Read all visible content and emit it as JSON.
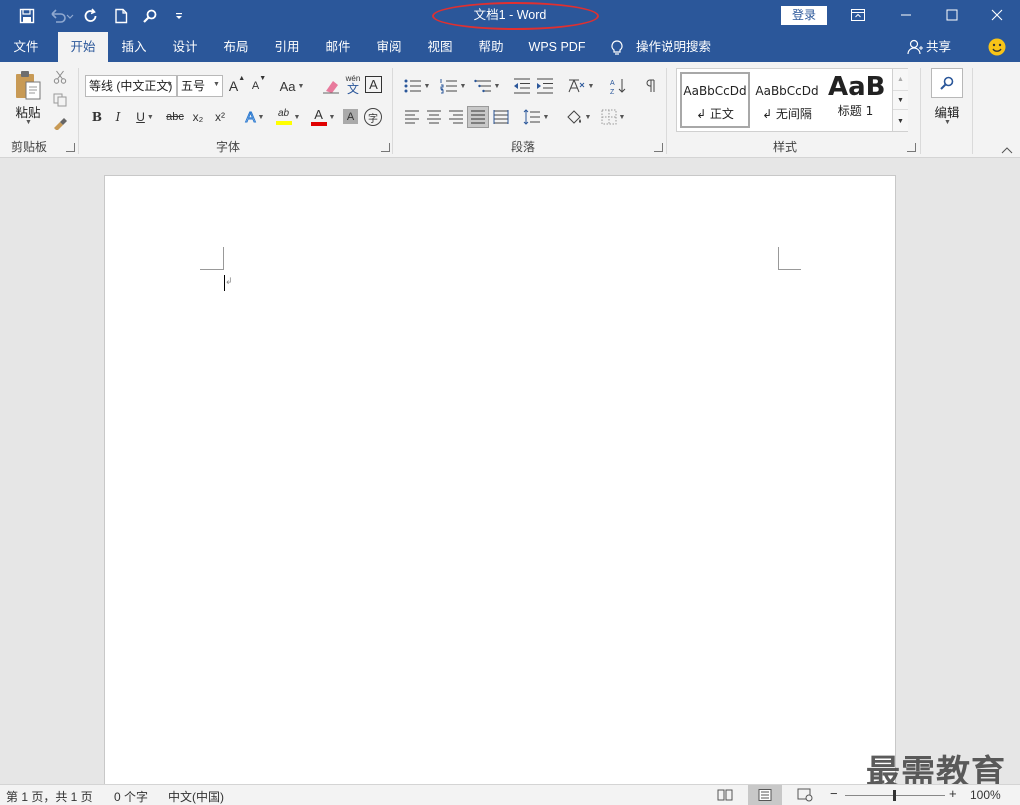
{
  "title": "文档1  -  Word",
  "login_label": "登录",
  "tabs": [
    "文件",
    "开始",
    "插入",
    "设计",
    "布局",
    "引用",
    "邮件",
    "审阅",
    "视图",
    "帮助",
    "WPS PDF"
  ],
  "tell_me": "操作说明搜索",
  "share": "共享",
  "clipboard": {
    "paste_label": "粘贴",
    "group_label": "剪贴板"
  },
  "font": {
    "name_value": "等线 (中文正文)",
    "size_value": "五号",
    "change_case_label": "Aa",
    "phonetic_top": "wén",
    "phonetic_bottom": "文",
    "border_char_label": "A",
    "bold_label": "B",
    "italic_label": "I",
    "underline_label": "U",
    "strike_label": "abc",
    "subscript_label": "x₂",
    "superscript_label": "x²",
    "text_effect_label": "A",
    "highlight_label": "ab",
    "font_color_label": "A",
    "char_shading_label": "A",
    "enclose_label": "字",
    "grow_label": "A",
    "shrink_label": "A",
    "group_label": "字体"
  },
  "paragraph": {
    "group_label": "段落"
  },
  "styles": {
    "items": [
      {
        "preview": "AaBbCcDd",
        "name": "↲ 正文"
      },
      {
        "preview": "AaBbCcDd",
        "name": "↲ 无间隔"
      },
      {
        "preview": "AaBb",
        "name": "标题 1"
      }
    ],
    "group_label": "样式"
  },
  "editing": {
    "label": "编辑"
  },
  "status": {
    "page": "第 1 页，共 1 页",
    "words": "0 个字",
    "language": "中文(中国)",
    "zoom": "100%",
    "zoom_minus": "−",
    "zoom_plus": "+"
  },
  "watermark": "最需教育",
  "colors": {
    "brand": "#2b579a",
    "highlight": "#ffff00",
    "font_color": "#e00000",
    "annotation": "#e03030"
  }
}
